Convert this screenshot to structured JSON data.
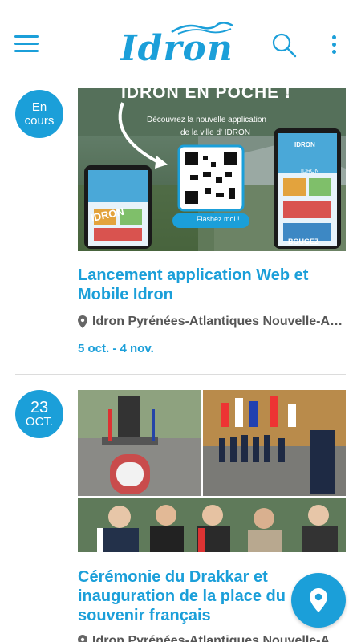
{
  "app": {
    "logo_text": "Idron"
  },
  "colors": {
    "accent": "#1b9fd9",
    "text_muted": "#555555"
  },
  "header": {
    "menu_icon": "hamburger-menu-icon",
    "search_icon": "search-icon",
    "more_icon": "more-vertical-icon"
  },
  "events": [
    {
      "badge_line1": "En",
      "badge_line2": "cours",
      "poster": {
        "headline": "IDRON EN POCHE !",
        "subline1": "Découvrez la nouvelle application",
        "subline2": "de la ville d' IDRON",
        "button": "Flashez moi !",
        "phone_label": "IDRON",
        "phone_label2": "IDRON",
        "sticker": "IDRON",
        "sticker2": "BOUGEZ"
      },
      "title": "Lancement application Web et Mobile Idron",
      "location": "Idron Pyrénées-Atlantiques Nouvelle-Aquitaine",
      "dates": "5 oct. - 4 nov."
    },
    {
      "badge_line1": "23",
      "badge_line2": "OCT.",
      "title": "Cérémonie du Drakkar et inauguration de la place du souvenir français",
      "location": "Idron Pyrénées-Atlantiques Nouvelle-Aquitaine"
    }
  ],
  "fab": {
    "icon": "map-pin-icon"
  }
}
